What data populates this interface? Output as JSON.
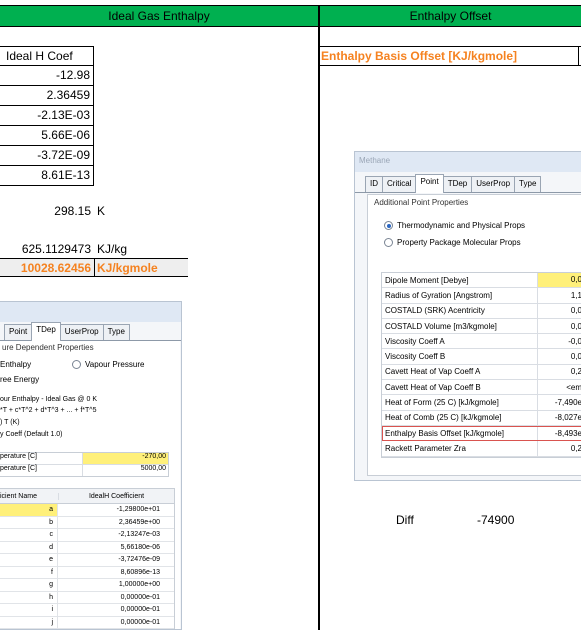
{
  "headers": {
    "left": "Ideal Gas Enthalpy",
    "right": "Enthalpy Offset"
  },
  "colors": {
    "header_bg": "#00b050",
    "accent_orange": "#f58220",
    "highlight_yellow": "#fff07a",
    "red_border": "#d9534f"
  },
  "table": {
    "col_header": "Ideal H Coef",
    "values": [
      "-12.98",
      "2.36459",
      "-2.13E-03",
      "5.66E-06",
      "-3.72E-09",
      "8.61E-13"
    ]
  },
  "temperature": {
    "value": "298.15",
    "unit": "K"
  },
  "enthalpy_mass": {
    "value": "625.1129473",
    "unit": "KJ/kg"
  },
  "enthalpy_mole": {
    "value": "10028.62456",
    "unit": "KJ/kgmole"
  },
  "offset_label": "Enthalpy Basis Offset [KJ/kgmole]",
  "diff": {
    "label": "Diff",
    "value": "-74900"
  },
  "left_dialog": {
    "tabs": [
      "Point",
      "TDep",
      "UserProp",
      "Type"
    ],
    "selected_tab": "TDep",
    "group_label": "ure Dependent Properties",
    "radio_enthalpy": "Enthalpy",
    "radio_vapour": "Vapour Pressure",
    "free_energy": "ree Energy",
    "eq_line1": "our Enthalpy - Ideal Gas @ 0 K",
    "eq_line2": "*T + c*T^2 + d*T^3 + ... + f*T^5",
    "eq_line3": ")   T (K)",
    "eq_line4": "y Coeff  (Default 1.0)",
    "temp_rows": [
      {
        "label": "perature [C]",
        "value": "-270,00"
      },
      {
        "label": "perature [C]",
        "value": "5000,00"
      }
    ],
    "coef_header_name": "icient Name",
    "coef_header_val": "IdealH Coefficient",
    "coefs": [
      {
        "name": "a",
        "value": "-1,29800e+01"
      },
      {
        "name": "b",
        "value": "2,36459e+00"
      },
      {
        "name": "c",
        "value": "-2,13247e-03"
      },
      {
        "name": "d",
        "value": "5,66180e-06"
      },
      {
        "name": "e",
        "value": "-3,72476e-09"
      },
      {
        "name": "f",
        "value": "8,60896e-13"
      },
      {
        "name": "g",
        "value": "1,00000e+00"
      },
      {
        "name": "h",
        "value": "0,00000e-01"
      },
      {
        "name": "i",
        "value": "0,00000e-01"
      },
      {
        "name": "j",
        "value": "0,00000e-01"
      }
    ]
  },
  "right_dialog": {
    "title": "Methane",
    "tabs": [
      "ID",
      "Critical",
      "Point",
      "TDep",
      "UserProp",
      "Type"
    ],
    "selected_tab": "Point",
    "group_label": "Additional Point Properties",
    "radio1": "Thermodynamic and Physical Props",
    "radio2": "Property Package Molecular Props",
    "props": [
      {
        "name": "Dipole Moment [Debye]",
        "value": "0,0"
      },
      {
        "name": "Radius of Gyration [Angstrom]",
        "value": "1,1"
      },
      {
        "name": "COSTALD (SRK) Acentricity",
        "value": "0,0"
      },
      {
        "name": "COSTALD Volume [m3/kgmole]",
        "value": "0,0"
      },
      {
        "name": "Viscosity Coeff A",
        "value": "-0,0"
      },
      {
        "name": "Viscosity Coeff B",
        "value": "0,0"
      },
      {
        "name": "Cavett Heat of Vap Coeff A",
        "value": "0,2"
      },
      {
        "name": "Cavett Heat of Vap Coeff B",
        "value": "<em"
      },
      {
        "name": "Heat of Form (25 C) [kJ/kgmole]",
        "value": "-7,490e"
      },
      {
        "name": "Heat of Comb (25 C) [kJ/kgmole]",
        "value": "-8,027e"
      },
      {
        "name": "Enthalpy Basis Offset [kJ/kgmole]",
        "value": "-8,493e"
      },
      {
        "name": "Rackett Parameter Zra",
        "value": "0,2"
      }
    ]
  }
}
